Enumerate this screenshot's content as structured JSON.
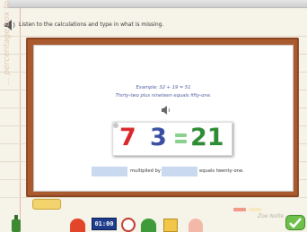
{
  "instruction": "Listen to the calculations and type in what is missing.",
  "decoration_text": "... percentage box to ...",
  "example": {
    "equation": "Example: 32 + 19 = 51",
    "words": "Thirty-two plus nineteen equals fifty-one."
  },
  "equation": {
    "first": "7",
    "operator_blank": "",
    "second": "3",
    "result": "21"
  },
  "answer_sentence": {
    "blank1_value": "",
    "middle": "multiplied by",
    "blank2_value": "",
    "end": "equals twenty-one."
  },
  "toolbar": {
    "timer": "01:00"
  },
  "signature": "Zoe Nolte",
  "colors": {
    "board": "#a95a2e",
    "first_number": "#d8282a",
    "second_number": "#3a4fa3",
    "result": "#2e8c35",
    "blank": "#c9d9ef"
  },
  "icons": [
    "speaker-icon",
    "sponge-icon",
    "chalk-icon",
    "bottle-icon",
    "clock-icon",
    "help-icon",
    "book-icon",
    "ok-check-icon"
  ]
}
